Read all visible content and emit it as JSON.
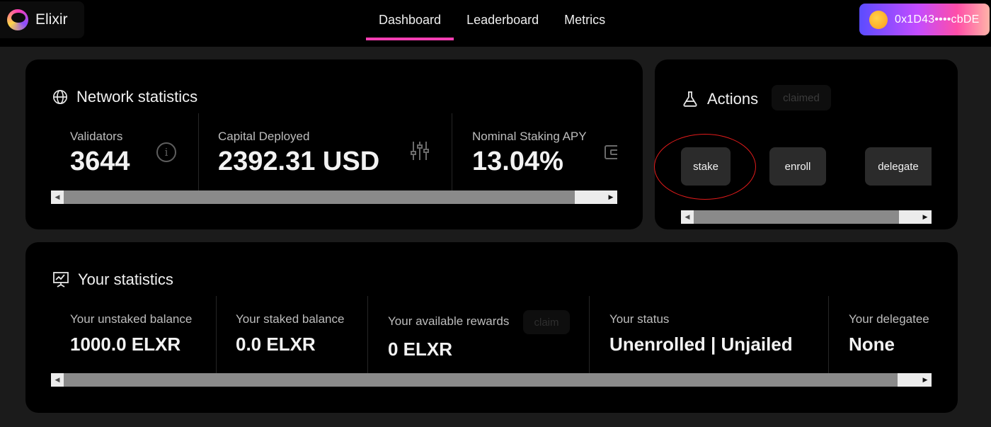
{
  "header": {
    "brand": "Elixir",
    "tabs": [
      {
        "label": "Dashboard",
        "active": true
      },
      {
        "label": "Leaderboard",
        "active": false
      },
      {
        "label": "Metrics",
        "active": false
      }
    ],
    "wallet_address": "0x1D43••••cbDE"
  },
  "network": {
    "title": "Network statistics",
    "stats": [
      {
        "label": "Validators",
        "value": "3644",
        "icon": "info-icon"
      },
      {
        "label": "Capital Deployed",
        "value": "2392.31 USD",
        "icon": "sliders-icon"
      },
      {
        "label": "Nominal Staking APY",
        "value": "13.04%",
        "icon": "wallet-icon"
      }
    ]
  },
  "actions": {
    "title": "Actions",
    "badge": "claimed",
    "buttons": [
      "stake",
      "enroll",
      "delegate"
    ]
  },
  "yours": {
    "title": "Your statistics",
    "stats": [
      {
        "label": "Your unstaked balance",
        "value": "1000.0 ELXR"
      },
      {
        "label": "Your staked balance",
        "value": "0.0 ELXR"
      },
      {
        "label": "Your available rewards",
        "value": "0 ELXR",
        "action": "claim"
      },
      {
        "label": "Your status",
        "value": "Unenrolled | Unjailed"
      },
      {
        "label": "Your delegatee",
        "value": "None"
      }
    ]
  },
  "colors": {
    "accent": "#ff3fb4",
    "card_bg": "#000000",
    "page_bg": "#1b1b1b",
    "annotation": "#e21b1b"
  }
}
